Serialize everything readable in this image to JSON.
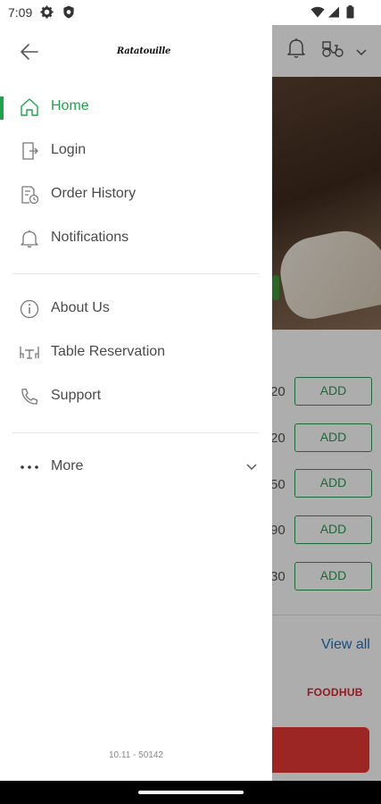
{
  "status_bar": {
    "time": "7:09",
    "left_icons": [
      "gear-icon",
      "shield-icon"
    ],
    "right_icons": [
      "wifi-icon",
      "signal-icon",
      "battery-icon"
    ]
  },
  "drawer": {
    "brand": "Ratatouille",
    "primary_items": [
      {
        "label": "Home",
        "icon": "home-icon",
        "active": true
      },
      {
        "label": "Login",
        "icon": "login-icon",
        "active": false
      },
      {
        "label": "Order History",
        "icon": "order-history-icon",
        "active": false
      },
      {
        "label": "Notifications",
        "icon": "bell-icon",
        "active": false
      }
    ],
    "secondary_items": [
      {
        "label": "About Us",
        "icon": "info-icon"
      },
      {
        "label": "Table Reservation",
        "icon": "table-reservation-icon"
      },
      {
        "label": "Support",
        "icon": "phone-icon"
      }
    ],
    "more_label": "More",
    "version": "10.11 - 50142"
  },
  "background": {
    "header_icons": [
      "bell-icon",
      "delivery-scooter-icon",
      "chevron-down-icon"
    ],
    "price_fragments": [
      "20",
      "20",
      "50",
      "90",
      "30"
    ],
    "add_label": "ADD",
    "view_all": "View all",
    "footer_brand": "FOODHUB"
  },
  "colors": {
    "accent_green": "#1fa34a",
    "add_border": "#2e9a58",
    "link_blue": "#1e73be",
    "brand_red": "#d7262e",
    "cta_red": "#e53935"
  }
}
